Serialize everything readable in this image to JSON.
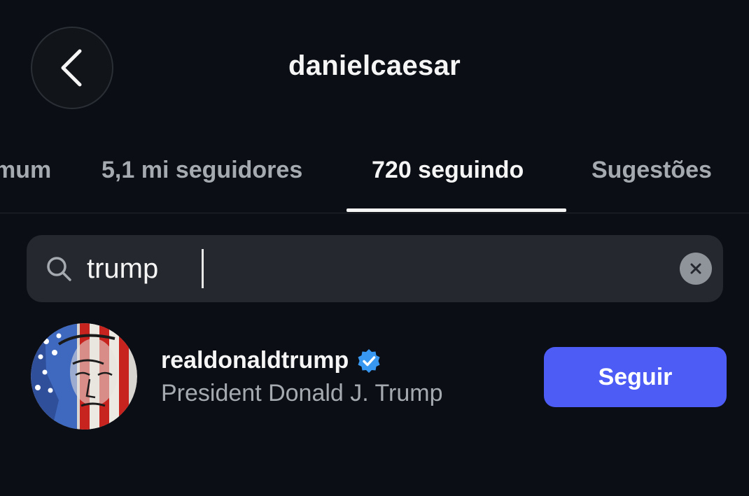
{
  "header": {
    "title": "danielcaesar",
    "back_icon": "chevron-left-icon"
  },
  "tabs": [
    {
      "label": "mum",
      "active": false
    },
    {
      "label": "5,1 mi seguidores",
      "active": false
    },
    {
      "label": "720 seguindo",
      "active": true
    },
    {
      "label": "Sugestões",
      "active": false
    }
  ],
  "search": {
    "icon": "search-icon",
    "value": "trump",
    "clear_icon": "close-circle-icon"
  },
  "results": [
    {
      "username": "realdonaldtrump",
      "verified": true,
      "verified_icon": "verified-badge-icon",
      "full_name": "President Donald J. Trump",
      "follow_label": "Seguir"
    }
  ],
  "colors": {
    "background": "#0b0f15",
    "accent": "#4c5cf5",
    "verified": "#3897f0",
    "muted_text": "#a5a9b0"
  }
}
